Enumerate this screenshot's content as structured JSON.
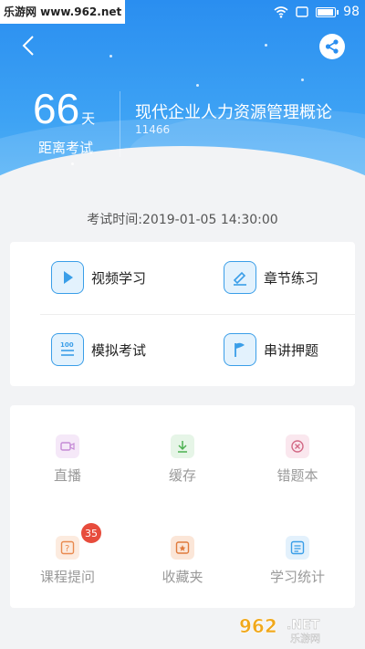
{
  "status_bar": {
    "watermark": "乐游网 www.962.net",
    "battery": "98",
    "battery_level": 0.98
  },
  "header": {
    "days_number": "66",
    "days_unit": "天",
    "until_label": "距离考试",
    "course_title": "现代企业人力资源管理概论",
    "course_code": "11466"
  },
  "exam_time": "考试时间:2019-01-05 14:30:00",
  "features": [
    {
      "label": "视频学习",
      "icon": "play-icon"
    },
    {
      "label": "章节练习",
      "icon": "edit-icon"
    },
    {
      "label": "模拟考试",
      "icon": "exam-100-icon"
    },
    {
      "label": "串讲押题",
      "icon": "flag-icon"
    }
  ],
  "tools": [
    {
      "label": "直播",
      "icon": "live-video-icon",
      "color": "#c58bd6"
    },
    {
      "label": "缓存",
      "icon": "download-icon",
      "color": "#4cb050"
    },
    {
      "label": "错题本",
      "icon": "wrong-book-icon",
      "color": "#d36a86"
    },
    {
      "label": "课程提问",
      "icon": "question-icon",
      "color": "#e98a4f",
      "badge": "35"
    },
    {
      "label": "收藏夹",
      "icon": "favorite-icon",
      "color": "#e07a3c"
    },
    {
      "label": "学习统计",
      "icon": "stats-icon",
      "color": "#3a9ee8"
    }
  ],
  "watermark_logo": "962.NET 乐游网",
  "colors": {
    "header_blue": "#2a8ef0",
    "accent": "#3a9ee8",
    "badge_red": "#e74c3c"
  }
}
